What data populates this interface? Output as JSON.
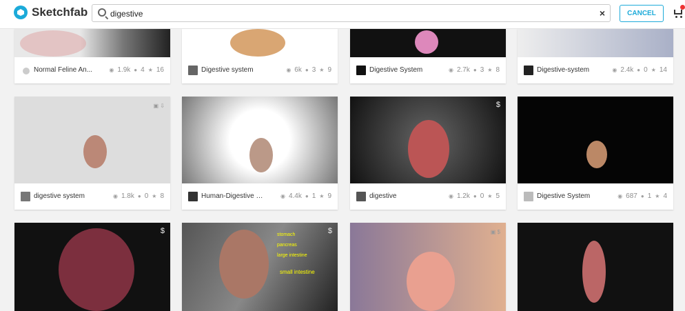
{
  "header": {
    "brand": "Sketchfab",
    "search_value": "digestive",
    "cancel_label": "CANCEL"
  },
  "cards": [
    {
      "title": "Normal Feline An...",
      "views": "1.9k",
      "comments": "4",
      "likes": "16"
    },
    {
      "title": "Digestive system",
      "views": "6k",
      "comments": "3",
      "likes": "9"
    },
    {
      "title": "Digestive System",
      "views": "2.7k",
      "comments": "3",
      "likes": "8"
    },
    {
      "title": "Digestive-system",
      "views": "2.4k",
      "comments": "0",
      "likes": "14"
    },
    {
      "title": "digestive system",
      "views": "1.8k",
      "comments": "0",
      "likes": "8"
    },
    {
      "title": "Human-Digestive S...",
      "views": "4.4k",
      "comments": "1",
      "likes": "9"
    },
    {
      "title": "digestive",
      "views": "1.2k",
      "comments": "0",
      "likes": "5",
      "price": "$"
    },
    {
      "title": "Digestive System",
      "views": "687",
      "comments": "1",
      "likes": "4"
    },
    {
      "title": "",
      "views": "",
      "comments": "",
      "likes": "",
      "price": "$"
    },
    {
      "title": "",
      "views": "",
      "comments": "",
      "likes": "",
      "price": "$"
    }
  ],
  "labels": {
    "stomach": "stomach",
    "pancreas": "pancreas",
    "large_intestine": "large intestine",
    "small_intestine": "small intestine"
  }
}
